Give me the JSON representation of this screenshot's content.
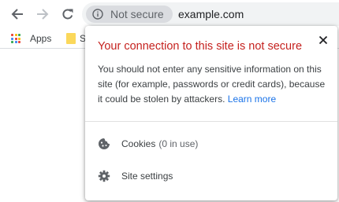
{
  "toolbar": {
    "security_chip": "Not secure",
    "url": "example.com"
  },
  "bookmarks": {
    "apps_label": "Apps",
    "folder_label": "S",
    "apps_colors": [
      "#ea4335",
      "#fbbc05",
      "#34a853",
      "#4285f4",
      "#ea4335",
      "#fbbc05",
      "#34a853",
      "#4285f4",
      "#ea4335"
    ]
  },
  "popup": {
    "title": "Your connection to this site is not secure",
    "description": "You should not enter any sensitive information on this site (for example, passwords or credit cards), because it could be stolen by attackers.",
    "learn_more": "Learn more",
    "cookies_label": "Cookies",
    "cookies_count": "(0 in use)",
    "site_settings_label": "Site settings"
  },
  "colors": {
    "warning_red": "#c5221f",
    "link_blue": "#1a73e8"
  },
  "icons": [
    "back-arrow-icon",
    "forward-arrow-icon",
    "reload-icon",
    "info-icon",
    "apps-grid-icon",
    "folder-icon",
    "close-icon",
    "cookie-icon",
    "gear-icon"
  ]
}
